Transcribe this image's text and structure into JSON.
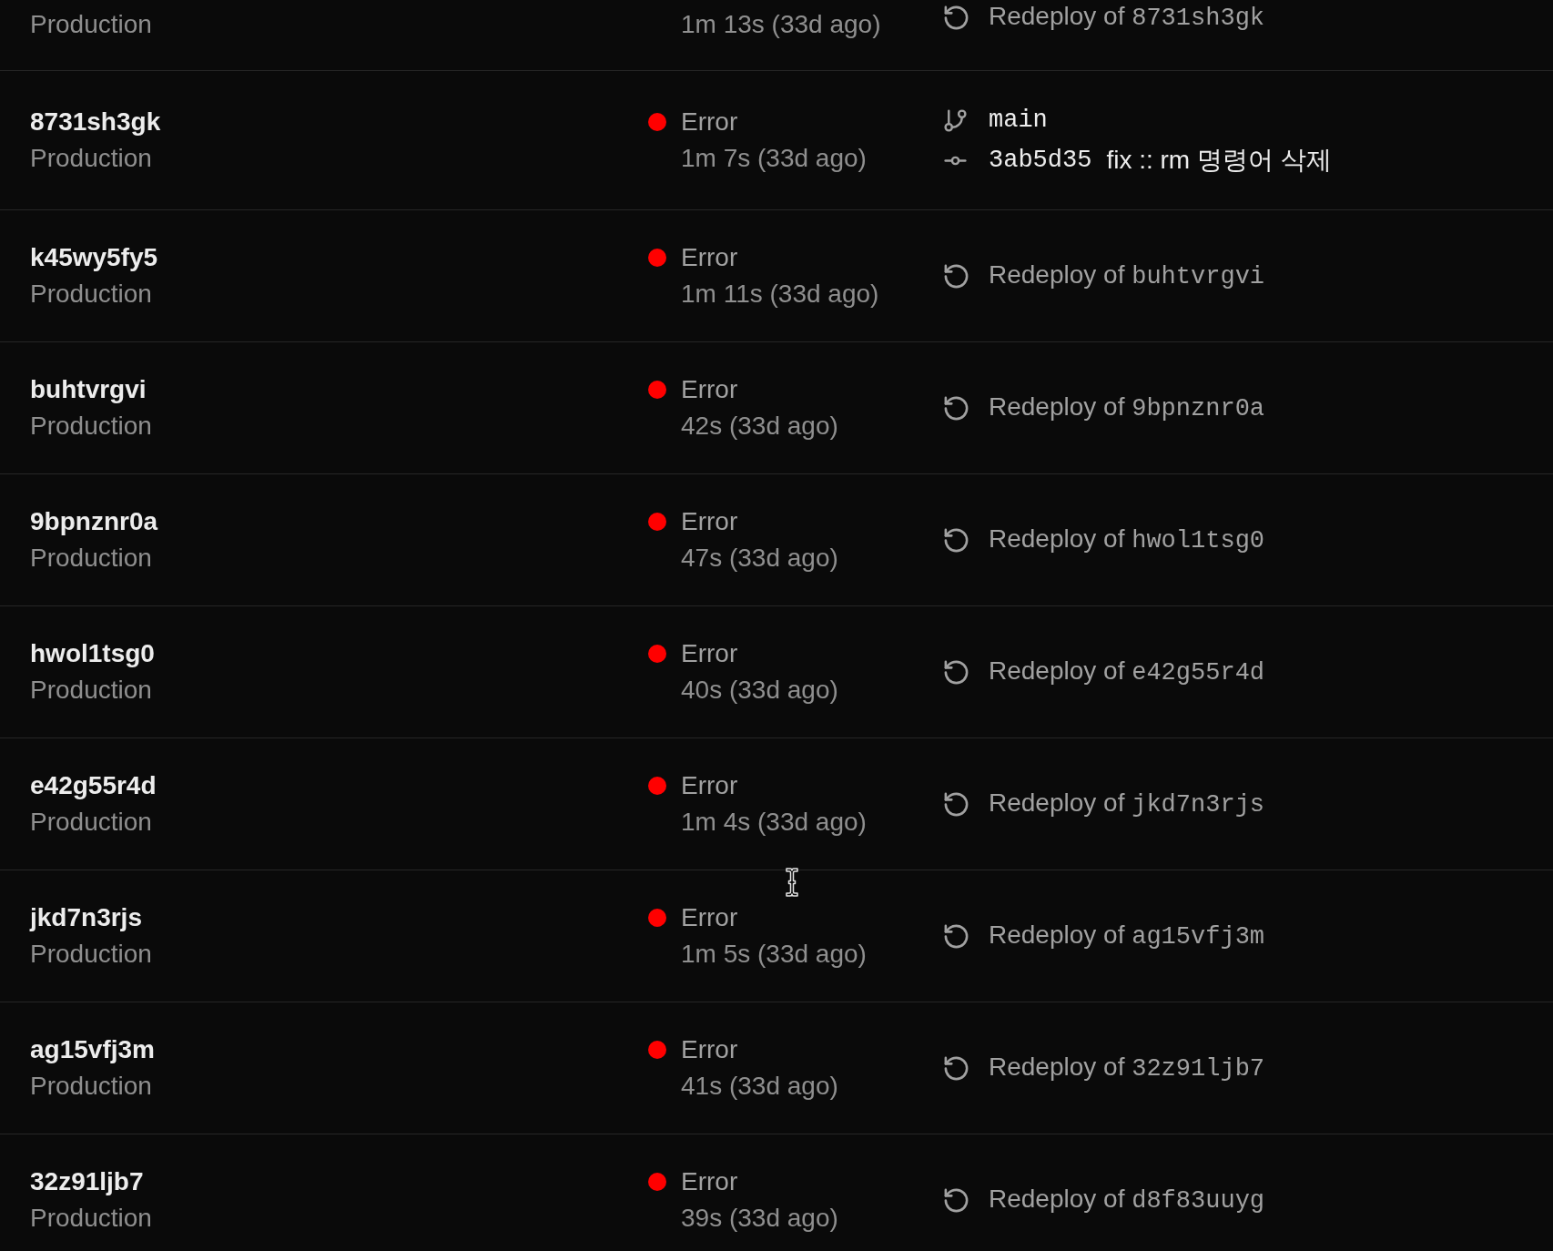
{
  "deployments": [
    {
      "environment": "Production",
      "duration": "1m 13s (33d ago)",
      "source": {
        "kind": "redeploy",
        "label": "Redeploy of",
        "ref": "8731sh3gk"
      }
    },
    {
      "id": "8731sh3gk",
      "environment": "Production",
      "status": {
        "label": "Error",
        "color": "#ff0000"
      },
      "duration": "1m 7s (33d ago)",
      "source": {
        "kind": "git",
        "branch": "main",
        "commit": "3ab5d35",
        "message": "fix :: rm 명령어 삭제"
      }
    },
    {
      "id": "k45wy5fy5",
      "environment": "Production",
      "status": {
        "label": "Error",
        "color": "#ff0000"
      },
      "duration": "1m 11s (33d ago)",
      "source": {
        "kind": "redeploy",
        "label": "Redeploy of",
        "ref": "buhtvrgvi"
      }
    },
    {
      "id": "buhtvrgvi",
      "environment": "Production",
      "status": {
        "label": "Error",
        "color": "#ff0000"
      },
      "duration": "42s (33d ago)",
      "source": {
        "kind": "redeploy",
        "label": "Redeploy of",
        "ref": "9bpnznr0a"
      }
    },
    {
      "id": "9bpnznr0a",
      "environment": "Production",
      "status": {
        "label": "Error",
        "color": "#ff0000"
      },
      "duration": "47s (33d ago)",
      "source": {
        "kind": "redeploy",
        "label": "Redeploy of",
        "ref": "hwol1tsg0"
      }
    },
    {
      "id": "hwol1tsg0",
      "environment": "Production",
      "status": {
        "label": "Error",
        "color": "#ff0000"
      },
      "duration": "40s (33d ago)",
      "source": {
        "kind": "redeploy",
        "label": "Redeploy of",
        "ref": "e42g55r4d"
      }
    },
    {
      "id": "e42g55r4d",
      "environment": "Production",
      "status": {
        "label": "Error",
        "color": "#ff0000"
      },
      "duration": "1m 4s (33d ago)",
      "source": {
        "kind": "redeploy",
        "label": "Redeploy of",
        "ref": "jkd7n3rjs"
      }
    },
    {
      "id": "jkd7n3rjs",
      "environment": "Production",
      "status": {
        "label": "Error",
        "color": "#ff0000"
      },
      "duration": "1m 5s (33d ago)",
      "source": {
        "kind": "redeploy",
        "label": "Redeploy of",
        "ref": "ag15vfj3m"
      }
    },
    {
      "id": "ag15vfj3m",
      "environment": "Production",
      "status": {
        "label": "Error",
        "color": "#ff0000"
      },
      "duration": "41s (33d ago)",
      "source": {
        "kind": "redeploy",
        "label": "Redeploy of",
        "ref": "32z91ljb7"
      }
    },
    {
      "id": "32z91ljb7",
      "environment": "Production",
      "status": {
        "label": "Error",
        "color": "#ff0000"
      },
      "duration": "39s (33d ago)",
      "source": {
        "kind": "redeploy",
        "label": "Redeploy of",
        "ref": "d8f83uuyg"
      }
    }
  ]
}
